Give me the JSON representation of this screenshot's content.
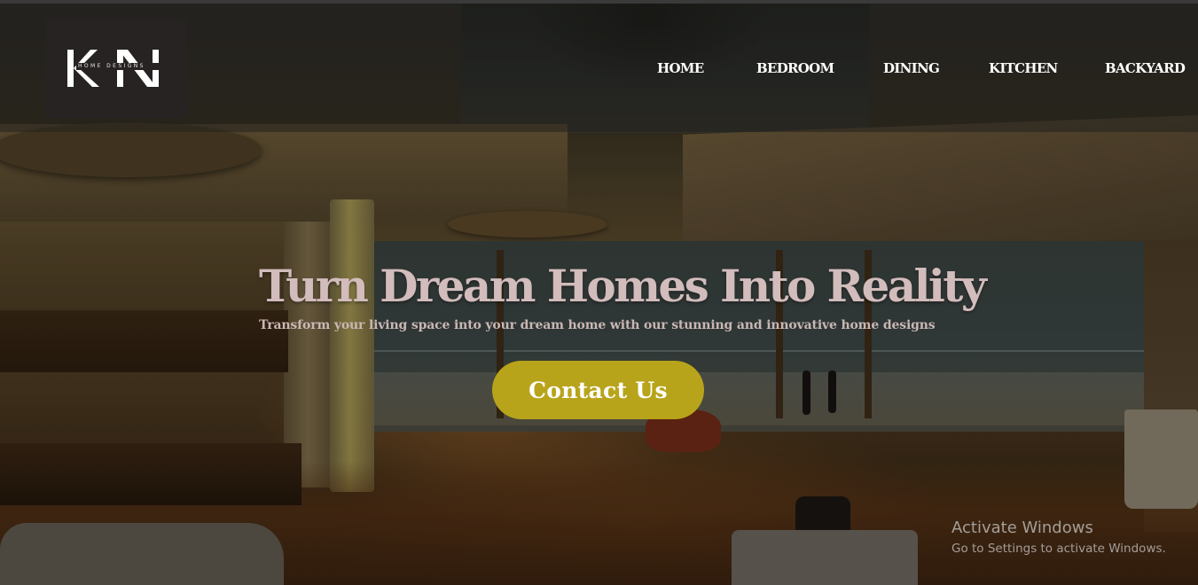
{
  "brand": {
    "logo_letters": "KN",
    "logo_subtitle": "HOME DESIGNS"
  },
  "nav": {
    "items": [
      {
        "label": "HOME"
      },
      {
        "label": "BEDROOM"
      },
      {
        "label": "DINING"
      },
      {
        "label": "KITCHEN"
      },
      {
        "label": "BACKYARD"
      }
    ]
  },
  "hero": {
    "title": "Turn Dream Homes Into Reality",
    "subtitle": "Transform your living space into your dream home with our stunning and innovative home designs",
    "cta_label": "Contact Us"
  },
  "watermark": {
    "title": "Activate Windows",
    "subtitle": "Go to Settings to activate Windows."
  },
  "colors": {
    "cta_background": "#b8a41a",
    "title_text": "#d2bcbc",
    "header_overlay": "#23211e",
    "logo_background": "#262322"
  }
}
